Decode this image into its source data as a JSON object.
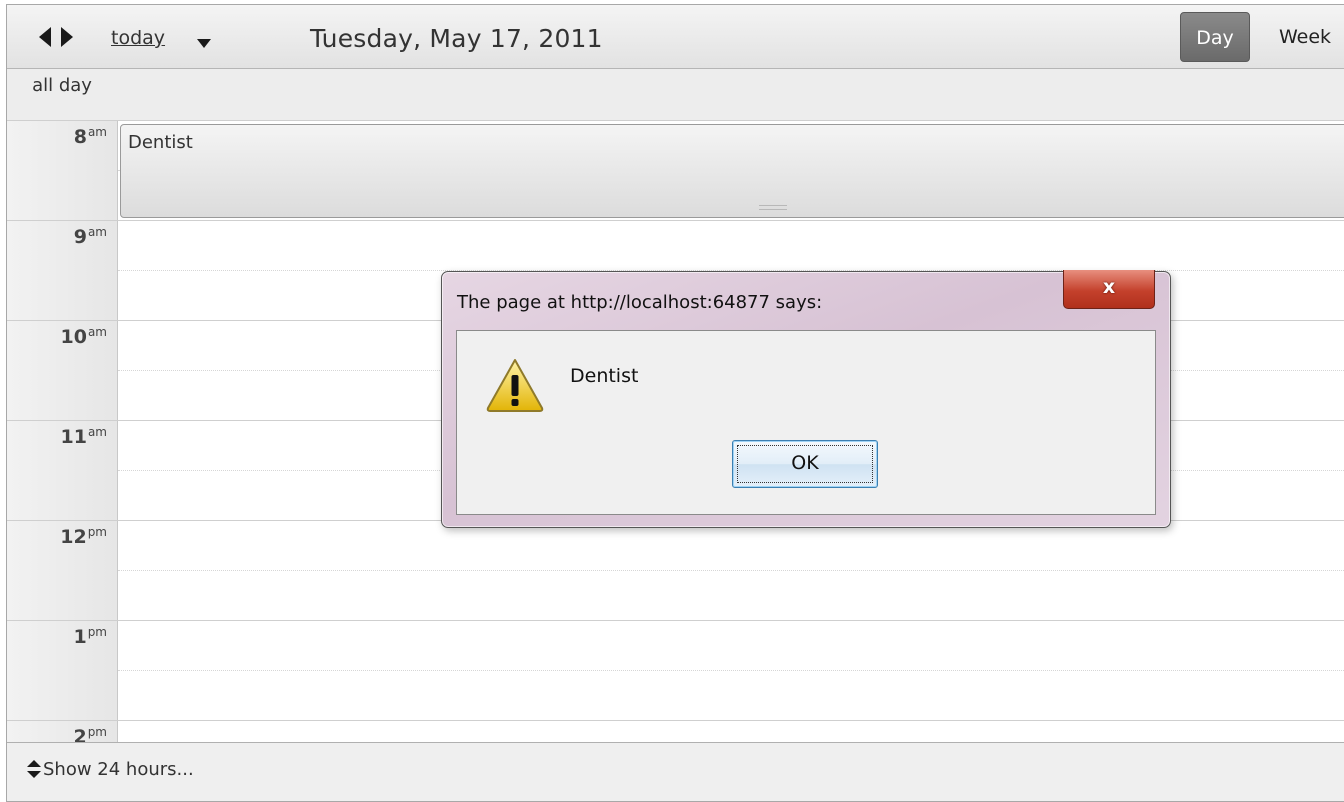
{
  "toolbar": {
    "prev_icon": "caret-left-icon",
    "next_icon": "caret-right-icon",
    "today_label": "today",
    "today_menu_icon": "caret-down-icon",
    "date_title": "Tuesday, May 17, 2011",
    "views": [
      {
        "label": "Day",
        "selected": true
      },
      {
        "label": "Week",
        "selected": false
      }
    ]
  },
  "grid": {
    "all_day_label": "all day",
    "hours": [
      {
        "num": "8",
        "suffix": "am"
      },
      {
        "num": "9",
        "suffix": "am"
      },
      {
        "num": "10",
        "suffix": "am"
      },
      {
        "num": "11",
        "suffix": "am"
      },
      {
        "num": "12",
        "suffix": "pm"
      },
      {
        "num": "1",
        "suffix": "pm"
      },
      {
        "num": "2",
        "suffix": "pm"
      }
    ]
  },
  "events": [
    {
      "title": "Dentist",
      "start": "8am",
      "end": "9am"
    }
  ],
  "footer": {
    "show_24_label": "Show 24 hours...",
    "icon": "up-down-arrows-icon"
  },
  "dialog": {
    "title": "The page at http://localhost:64877 says:",
    "close_label": "x",
    "icon": "warning-icon",
    "message": "Dentist",
    "ok_label": "OK"
  },
  "colors": {
    "day_button": "#6e6e6e",
    "dialog_frame": "#d9c5d6",
    "close_button": "#c4412c",
    "ok_border": "#3c7fb1"
  }
}
